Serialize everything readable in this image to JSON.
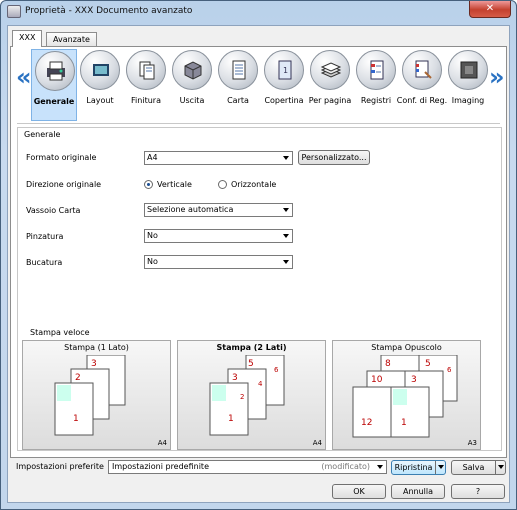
{
  "window": {
    "title": "Proprietà - XXX Documento avanzato",
    "close_label": "✕"
  },
  "tabs": [
    {
      "label": "XXX"
    },
    {
      "label": "Avanzate"
    }
  ],
  "nav": {
    "prev": "«",
    "next": "»"
  },
  "categories": [
    {
      "label": "Generale",
      "icon": "printer-icon",
      "selected": true
    },
    {
      "label": "Layout",
      "icon": "layout-icon"
    },
    {
      "label": "Finitura",
      "icon": "finishing-icon"
    },
    {
      "label": "Uscita",
      "icon": "output-icon"
    },
    {
      "label": "Carta",
      "icon": "paper-icon"
    },
    {
      "label": "Copertina",
      "icon": "cover-icon"
    },
    {
      "label": "Per pagina",
      "icon": "per-page-icon"
    },
    {
      "label": "Registri",
      "icon": "registers-icon"
    },
    {
      "label": "Conf. di Reg.",
      "icon": "register-config-icon"
    },
    {
      "label": "Imaging",
      "icon": "imaging-icon"
    }
  ],
  "general": {
    "group_title": "Generale",
    "formato": {
      "label": "Formato originale",
      "value": "A4",
      "button": "Personalizzato..."
    },
    "direzione": {
      "label": "Direzione originale",
      "opt1": "Verticale",
      "opt2": "Orizzontale",
      "selected": "Verticale"
    },
    "vassoio": {
      "label": "Vassoio Carta",
      "value": "Selezione automatica"
    },
    "pinzatura": {
      "label": "Pinzatura",
      "value": "No"
    },
    "bucatura": {
      "label": "Bucatura",
      "value": "No"
    }
  },
  "quick": {
    "title": "Stampa veloce",
    "cards": [
      {
        "title": "Stampa (1 Lato)",
        "size": "A4",
        "pages": [
          "3",
          "2",
          "1"
        ]
      },
      {
        "title": "Stampa (2 Lati)",
        "size": "A4",
        "selected": true,
        "pages": [
          "5",
          "6",
          "3",
          "4",
          "1",
          "2"
        ]
      },
      {
        "title": "Stampa Opuscolo",
        "size": "A3",
        "pages": [
          "8",
          "5",
          "6",
          "10",
          "3",
          "12",
          "1"
        ]
      }
    ]
  },
  "footer": {
    "pref_label": "Impostazioni preferite",
    "pref_value": "Impostazioni predefinite",
    "pref_modified": "(modificato)",
    "ripristina": "Ripristina",
    "salva": "Salva",
    "ok": "OK",
    "annulla": "Annulla",
    "help": "?"
  }
}
